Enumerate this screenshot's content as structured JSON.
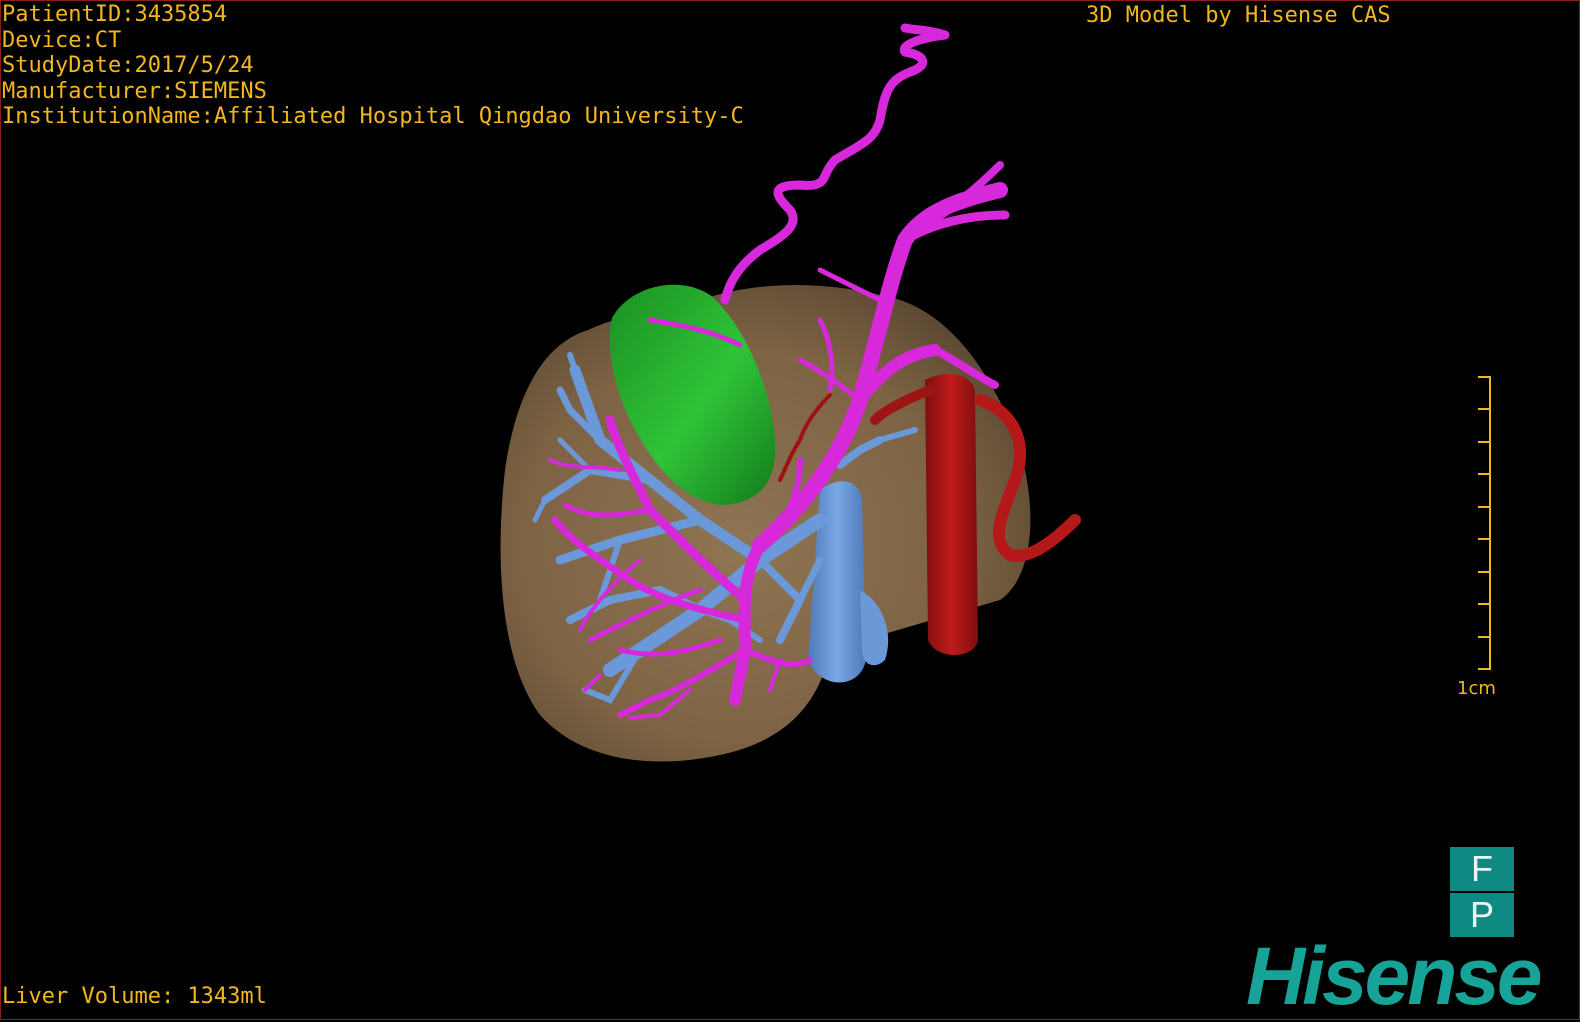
{
  "overlay": {
    "patient_id": "PatientID:3435854",
    "device": "Device:CT",
    "study_date": "StudyDate:2017/5/24",
    "manufacturer": "Manufacturer:SIEMENS",
    "institution": "InstitutionName:Affiliated Hospital Qingdao University-C",
    "credit": "3D Model by Hisense CAS",
    "liver_volume": "Liver Volume: 1343ml"
  },
  "scale": {
    "label": "1cm"
  },
  "orientation": {
    "top": "F",
    "bottom": "P"
  },
  "logo": {
    "text": "Hisense"
  },
  "colors": {
    "overlay_text": "#f2b61e",
    "liver": "#8a6e4b",
    "gallbladder": "#23a52b",
    "portal_vein": "#d528d8",
    "hepatic_vein": "#5d8fd2",
    "aorta": "#b51818",
    "logo": "#17a398"
  }
}
